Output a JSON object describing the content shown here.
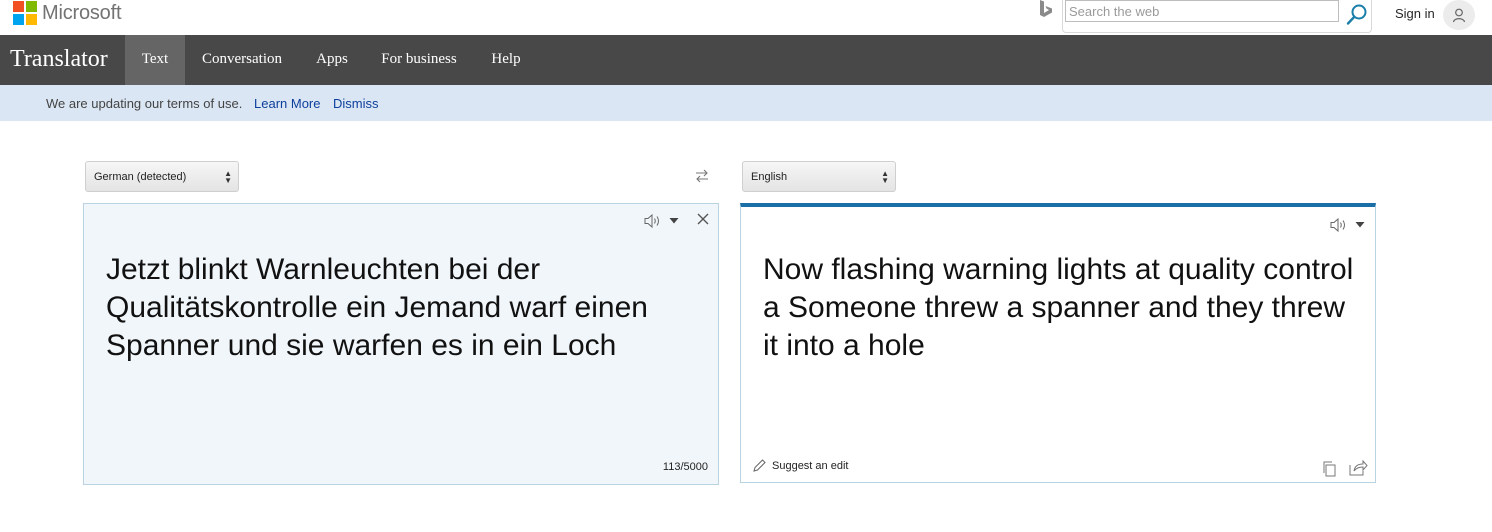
{
  "header": {
    "logo_text": "Microsoft",
    "logo_colors": [
      "#f25022",
      "#7fba00",
      "#00a4ef",
      "#ffb900"
    ],
    "search": {
      "placeholder": "Search the web",
      "value": ""
    },
    "signin_label": "Sign in"
  },
  "nav": {
    "brand": "Translator",
    "items": [
      {
        "label": "Text",
        "active": true
      },
      {
        "label": "Conversation",
        "active": false
      },
      {
        "label": "Apps",
        "active": false
      },
      {
        "label": "For business",
        "active": false
      },
      {
        "label": "Help",
        "active": false
      }
    ]
  },
  "notice": {
    "text": "We are updating our terms of use.",
    "learn_more": "Learn More",
    "dismiss": "Dismiss"
  },
  "source": {
    "language": "German (detected)",
    "text": "Jetzt blinkt Warnleuchten bei der Qualitätskontrolle ein Jemand warf einen Spanner und sie warfen es in ein Loch",
    "char_count": "113/5000"
  },
  "target": {
    "language": "English",
    "text": "Now flashing warning lights at quality control a Someone threw a spanner and they threw it into a hole",
    "suggest_edit": "Suggest an edit"
  },
  "colors": {
    "navbar": "#484848",
    "nav_active": "#656565",
    "notice_bg": "#dbe6f4",
    "link": "#0d3f9c",
    "accent": "#1a6fa8",
    "source_bg": "#f1f6fa"
  },
  "icons": [
    "bing-icon",
    "search-icon",
    "user-icon",
    "swap-icon",
    "speaker-icon",
    "dropdown-icon",
    "close-icon",
    "pencil-icon",
    "copy-icon",
    "share-icon"
  ]
}
